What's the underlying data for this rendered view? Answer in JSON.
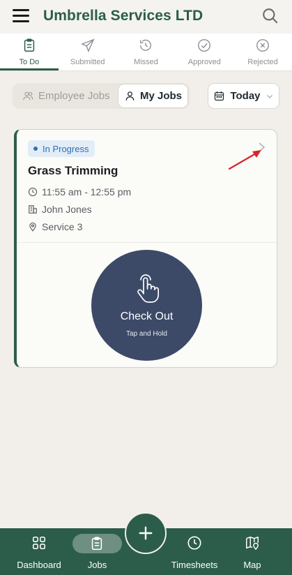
{
  "header": {
    "title": "Umbrella Services LTD",
    "menu_icon": "hamburger-icon",
    "search_icon": "search-icon"
  },
  "tabs": [
    {
      "label": "To Do",
      "icon": "clipboard-icon",
      "active": true
    },
    {
      "label": "Submitted",
      "icon": "send-icon",
      "active": false
    },
    {
      "label": "Missed",
      "icon": "clock-missed-icon",
      "active": false
    },
    {
      "label": "Approved",
      "icon": "check-circle-icon",
      "active": false
    },
    {
      "label": "Rejected",
      "icon": "x-circle-icon",
      "active": false
    }
  ],
  "filters": {
    "employee_jobs": "Employee Jobs",
    "my_jobs": "My Jobs",
    "date": "Today"
  },
  "job": {
    "status": "In Progress",
    "title": "Grass Trimming",
    "time": "11:55 am - 12:55 pm",
    "client": "John Jones",
    "service": "Service 3",
    "checkout_label": "Check Out",
    "checkout_hint": "Tap and Hold"
  },
  "bottom_nav": {
    "dashboard": "Dashboard",
    "jobs": "Jobs",
    "timesheets": "Timesheets",
    "map": "Map"
  },
  "colors": {
    "brand": "#2b5d4a",
    "checkout": "#3c4a68",
    "status_blue": "#2f6fb4",
    "annotation_red": "#d9232a"
  }
}
